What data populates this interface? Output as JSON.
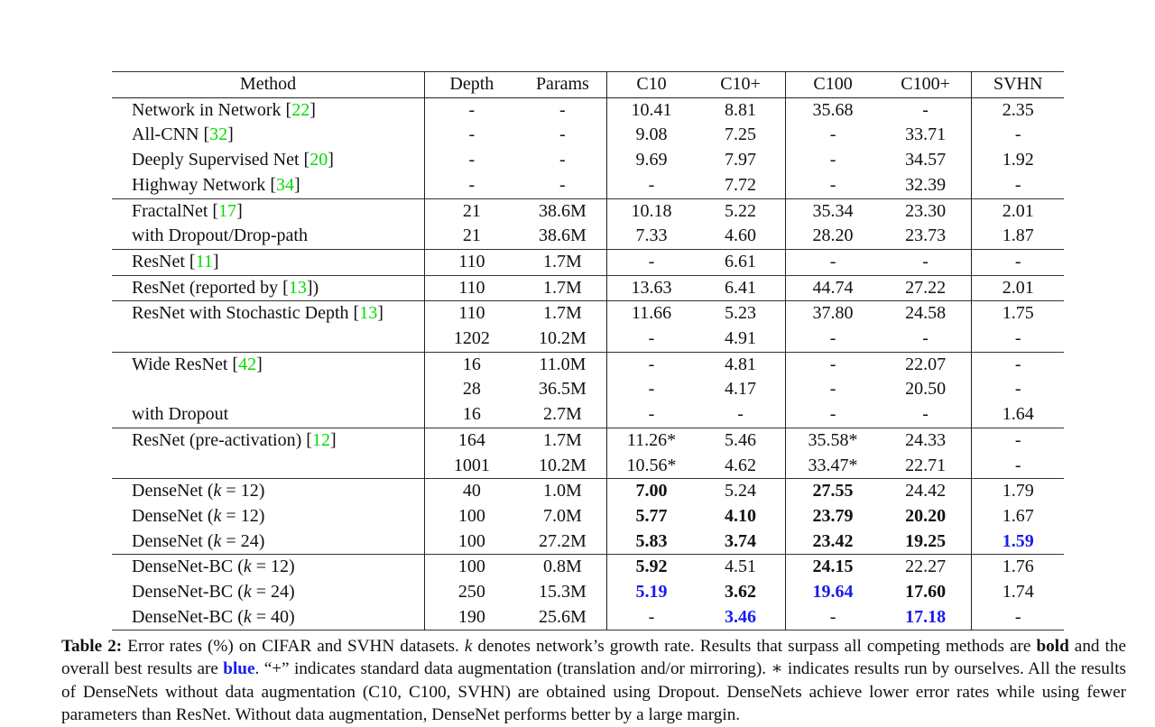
{
  "table": {
    "columns": [
      "Method",
      "Depth",
      "Params",
      "C10",
      "C10+",
      "C100",
      "C100+",
      "SVHN"
    ],
    "groups": [
      {
        "rows": [
          {
            "method": "Network in Network",
            "cite": "22",
            "depth": "-",
            "params": "-",
            "c10": "10.41",
            "c10p": "8.81",
            "c100": "35.68",
            "c100p": "-",
            "svhn": "2.35"
          },
          {
            "method": "All-CNN",
            "cite": "32",
            "depth": "-",
            "params": "-",
            "c10": "9.08",
            "c10p": "7.25",
            "c100": "-",
            "c100p": "33.71",
            "svhn": "-"
          },
          {
            "method": "Deeply Supervised Net",
            "cite": "20",
            "depth": "-",
            "params": "-",
            "c10": "9.69",
            "c10p": "7.97",
            "c100": "-",
            "c100p": "34.57",
            "svhn": "1.92"
          },
          {
            "method": "Highway Network",
            "cite": "34",
            "depth": "-",
            "params": "-",
            "c10": "-",
            "c10p": "7.72",
            "c100": "-",
            "c100p": "32.39",
            "svhn": "-"
          }
        ]
      },
      {
        "rows": [
          {
            "method": "FractalNet",
            "cite": "17",
            "depth": "21",
            "params": "38.6M",
            "c10": "10.18",
            "c10p": "5.22",
            "c100": "35.34",
            "c100p": "23.30",
            "svhn": "2.01"
          },
          {
            "method": "with Dropout/Drop-path",
            "depth": "21",
            "params": "38.6M",
            "c10": "7.33",
            "c10p": "4.60",
            "c100": "28.20",
            "c100p": "23.73",
            "svhn": "1.87"
          }
        ]
      },
      {
        "rows": [
          {
            "method": "ResNet",
            "cite": "11",
            "depth": "110",
            "params": "1.7M",
            "c10": "-",
            "c10p": "6.61",
            "c100": "-",
            "c100p": "-",
            "svhn": "-"
          }
        ]
      },
      {
        "rows": [
          {
            "method": "ResNet (reported by",
            "cite": "13",
            "suffix": ")",
            "depth": "110",
            "params": "1.7M",
            "c10": "13.63",
            "c10p": "6.41",
            "c100": "44.74",
            "c100p": "27.22",
            "svhn": "2.01"
          }
        ]
      },
      {
        "rows": [
          {
            "method": "ResNet with Stochastic Depth",
            "cite": "13",
            "depth": "110",
            "params": "1.7M",
            "c10": "11.66",
            "c10p": "5.23",
            "c100": "37.80",
            "c100p": "24.58",
            "svhn": "1.75"
          },
          {
            "method": "",
            "depth": "1202",
            "params": "10.2M",
            "c10": "-",
            "c10p": "4.91",
            "c100": "-",
            "c100p": "-",
            "svhn": "-"
          }
        ]
      },
      {
        "rows": [
          {
            "method": "Wide ResNet",
            "cite": "42",
            "depth": "16",
            "params": "11.0M",
            "c10": "-",
            "c10p": "4.81",
            "c100": "-",
            "c100p": "22.07",
            "svhn": "-"
          },
          {
            "method": "",
            "depth": "28",
            "params": "36.5M",
            "c10": "-",
            "c10p": "4.17",
            "c100": "-",
            "c100p": "20.50",
            "svhn": "-"
          },
          {
            "method": "with Dropout",
            "depth": "16",
            "params": "2.7M",
            "c10": "-",
            "c10p": "-",
            "c100": "-",
            "c100p": "-",
            "svhn": "1.64"
          }
        ]
      },
      {
        "rows": [
          {
            "method": "ResNet (pre-activation)",
            "cite": "12",
            "depth": "164",
            "params": "1.7M",
            "c10": "11.26*",
            "c10p": "5.46",
            "c100": "35.58*",
            "c100p": "24.33",
            "svhn": "-"
          },
          {
            "method": "",
            "depth": "1001",
            "params": "10.2M",
            "c10": "10.56*",
            "c10p": "4.62",
            "c100": "33.47*",
            "c100p": "22.71",
            "svhn": "-"
          }
        ]
      },
      {
        "rows": [
          {
            "method": "DenseNet",
            "k": "12",
            "depth": "40",
            "params": "1.0M",
            "c10": "7.00",
            "c10p": "5.24",
            "c100": "27.55",
            "c100p": "24.42",
            "svhn": "1.79",
            "bold": [
              "c10",
              "c100"
            ],
            "blue": []
          },
          {
            "method": "DenseNet",
            "k": "12",
            "depth": "100",
            "params": "7.0M",
            "c10": "5.77",
            "c10p": "4.10",
            "c100": "23.79",
            "c100p": "20.20",
            "svhn": "1.67",
            "bold": [
              "c10",
              "c10p",
              "c100",
              "c100p"
            ],
            "blue": []
          },
          {
            "method": "DenseNet",
            "k": "24",
            "depth": "100",
            "params": "27.2M",
            "c10": "5.83",
            "c10p": "3.74",
            "c100": "23.42",
            "c100p": "19.25",
            "svhn": "1.59",
            "bold": [
              "c10",
              "c10p",
              "c100",
              "c100p"
            ],
            "blue": [
              "svhn"
            ]
          }
        ]
      },
      {
        "rows": [
          {
            "method": "DenseNet-BC",
            "k": "12",
            "depth": "100",
            "params": "0.8M",
            "c10": "5.92",
            "c10p": "4.51",
            "c100": "24.15",
            "c100p": "22.27",
            "svhn": "1.76",
            "bold": [
              "c10",
              "c100"
            ],
            "blue": []
          },
          {
            "method": "DenseNet-BC",
            "k": "24",
            "depth": "250",
            "params": "15.3M",
            "c10": "5.19",
            "c10p": "3.62",
            "c100": "19.64",
            "c100p": "17.60",
            "svhn": "1.74",
            "bold": [
              "c10p",
              "c100p"
            ],
            "blue": [
              "c10",
              "c100"
            ]
          },
          {
            "method": "DenseNet-BC",
            "k": "40",
            "depth": "190",
            "params": "25.6M",
            "c10": "-",
            "c10p": "3.46",
            "c100": "-",
            "c100p": "17.18",
            "svhn": "-",
            "bold": [],
            "blue": [
              "c10p",
              "c100p"
            ]
          }
        ]
      }
    ]
  },
  "caption": {
    "label": "Table 2:",
    "part1": " Error rates (%) on CIFAR and SVHN datasets. ",
    "k": "k",
    "part2": " denotes network’s growth rate. Results that surpass all competing methods are ",
    "bold_word": "bold",
    "part3": " and the overall best results are ",
    "blue_word": "blue",
    "part4": ". “+” indicates standard data augmentation (translation and/or mirroring). ∗ indicates results run by ourselves. All the results of DenseNets without data augmentation (C10, C100, SVHN) are obtained using Dropout. DenseNets achieve lower error rates while using fewer parameters than ResNet. Without data augmentation, DenseNet performs better by a large margin."
  },
  "colors": {
    "citation": "#00dd00",
    "best_overall": "#1a1aee",
    "text": "#111111"
  }
}
